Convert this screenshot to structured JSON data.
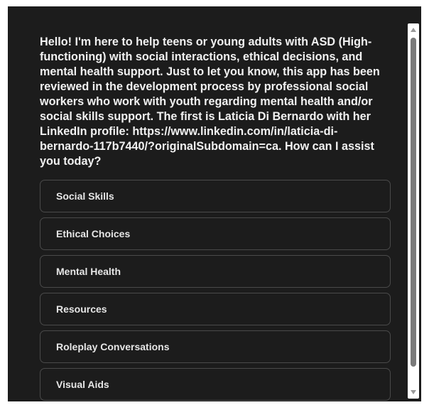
{
  "chat": {
    "message": "Hello! I'm here to help teens or young adults with ASD (High-functioning) with social interactions, ethical decisions, and mental health support. Just to let you know, this app has been reviewed in the development process by professional social workers who work with youth regarding mental health and/or social skills support. The first is Laticia Di Bernardo with her LinkedIn profile: https://www.linkedin.com/in/laticia-di-bernardo-117b7440/?originalSubdomain=ca. How can I assist you today?",
    "options": [
      {
        "label": "Social Skills"
      },
      {
        "label": "Ethical Choices"
      },
      {
        "label": "Mental Health"
      },
      {
        "label": "Resources"
      },
      {
        "label": "Roleplay Conversations"
      },
      {
        "label": "Visual Aids"
      }
    ]
  },
  "colors": {
    "panel_background": "#1c1c1c",
    "text": "#f1f1f1",
    "option_border": "#4a4a4a",
    "scrollbar_thumb": "#7a7a7a"
  },
  "icons": {
    "scroll_up": "triangle-up-icon",
    "scroll_down": "triangle-down-icon"
  }
}
